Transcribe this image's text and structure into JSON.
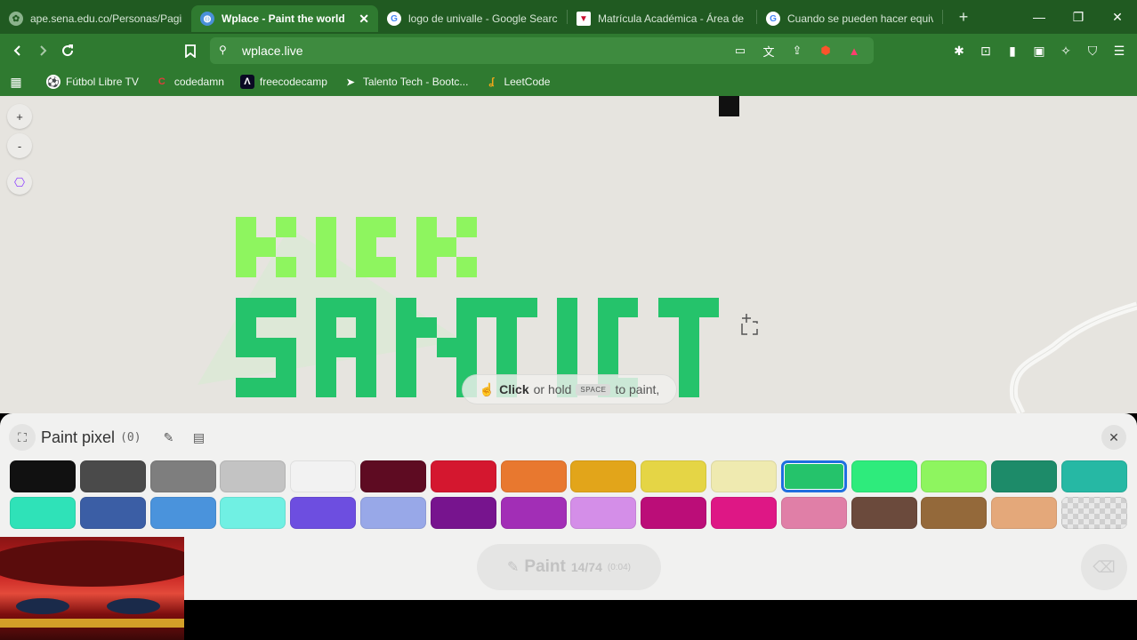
{
  "tabs": [
    {
      "title": "ape.sena.edu.co/Personas/Paginas",
      "icon": "sena-favicon-icon",
      "active": false
    },
    {
      "title": "Wplace - Paint the world",
      "icon": "wplace-favicon-icon",
      "active": true
    },
    {
      "title": "logo de univalle - Google Search",
      "icon": "google-favicon-icon",
      "active": false
    },
    {
      "title": "Matrícula Académica - Área de Re",
      "icon": "univalle-favicon-icon",
      "active": false
    },
    {
      "title": "Cuando se pueden hacer equivale",
      "icon": "google-favicon-icon",
      "active": false
    }
  ],
  "address_bar": {
    "url": "wplace.live"
  },
  "bookmarks": [
    {
      "label": "Fútbol Libre TV",
      "icon": "soccer-ball-icon"
    },
    {
      "label": "codedamn",
      "icon": "codedamn-icon"
    },
    {
      "label": "freecodecamp",
      "icon": "freecodecamp-icon"
    },
    {
      "label": "Talento Tech - Bootc...",
      "icon": "talento-tech-icon"
    },
    {
      "label": "LeetCode",
      "icon": "leetcode-icon"
    }
  ],
  "map_controls": {
    "zoom_in": "+",
    "zoom_out": "-"
  },
  "hint": {
    "click": "Click",
    "or_hold": "or hold",
    "key": "SPACE",
    "to_paint": "to paint,"
  },
  "panel": {
    "title": "Paint pixel",
    "count": "(0)",
    "paint_label": "Paint",
    "charges": "14/74",
    "cooldown": "(0:04)"
  },
  "palette": [
    "#111111",
    "#4a4a4a",
    "#7e7e7e",
    "#c3c3c3",
    "#f2f2f2",
    "#5e0b22",
    "#d4172f",
    "#e8782f",
    "#e2a51a",
    "#e5d545",
    "#efeab0",
    "#25c36b",
    "#2eeb7c",
    "#8ef55f",
    "#1d8b69",
    "#26b8a4",
    "#2fe2b8",
    "#3b5ea5",
    "#4a93dc",
    "#70f0e3",
    "#6d4ee0",
    "#98a8e8",
    "#77148e",
    "#a22eb6",
    "#d48ee8",
    "#bb0d78",
    "#de1785",
    "#e07fa7",
    "#6b4a3c",
    "#94693a",
    "#e4a87a",
    "transparent"
  ],
  "selected_color_index": 11,
  "colors": {
    "chrome_dark": "#205a21",
    "chrome": "#2f7a30",
    "pixel_green": "#25c36b",
    "pixel_lime": "#8ef55f"
  }
}
